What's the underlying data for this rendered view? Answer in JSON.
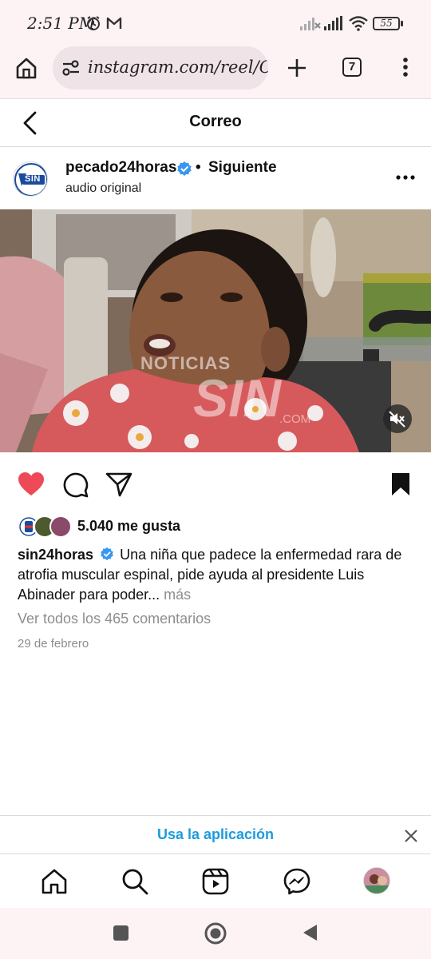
{
  "status_bar": {
    "time": "2:51 PM",
    "battery": "55",
    "icons": [
      "alarm-icon",
      "gmail-icon",
      "signal-icon",
      "wifi-icon",
      "battery-icon"
    ]
  },
  "browser": {
    "url": "instagram.com/reel/C",
    "tab_count": "7",
    "icons": [
      "home-icon",
      "site-settings-icon",
      "new-tab-icon",
      "tabs-icon",
      "more-icon"
    ]
  },
  "header": {
    "title": "Correo"
  },
  "post": {
    "username": "pecado24horas",
    "separator": "•",
    "follow_label": "Siguiente",
    "audio": "audio original",
    "avatar_text": "SIN",
    "video_watermark_top": "NOTICIAS",
    "video_watermark_main": "SIN",
    "video_watermark_domain": ".COM",
    "likes": "5.040 me gusta",
    "caption_user": "sin24horas",
    "caption_text": "Una niña que padece la enfermedad rara de atrofia muscular espinal, pide ayuda al presidente Luis Abinader para poder...",
    "caption_more": "más",
    "comments_link": "Ver todos los 465 comentarios",
    "date": "29 de febrero",
    "liked": true,
    "saved": true
  },
  "app_banner": {
    "label": "Usa la aplicación"
  },
  "bottom_nav": [
    "home-icon",
    "search-icon",
    "reels-icon",
    "messenger-icon",
    "profile-avatar"
  ],
  "colors": {
    "heart": "#ed4956",
    "link_blue": "#1c9bdc",
    "verified": "#3897f0",
    "chrome_bg": "#fdf3f5"
  }
}
